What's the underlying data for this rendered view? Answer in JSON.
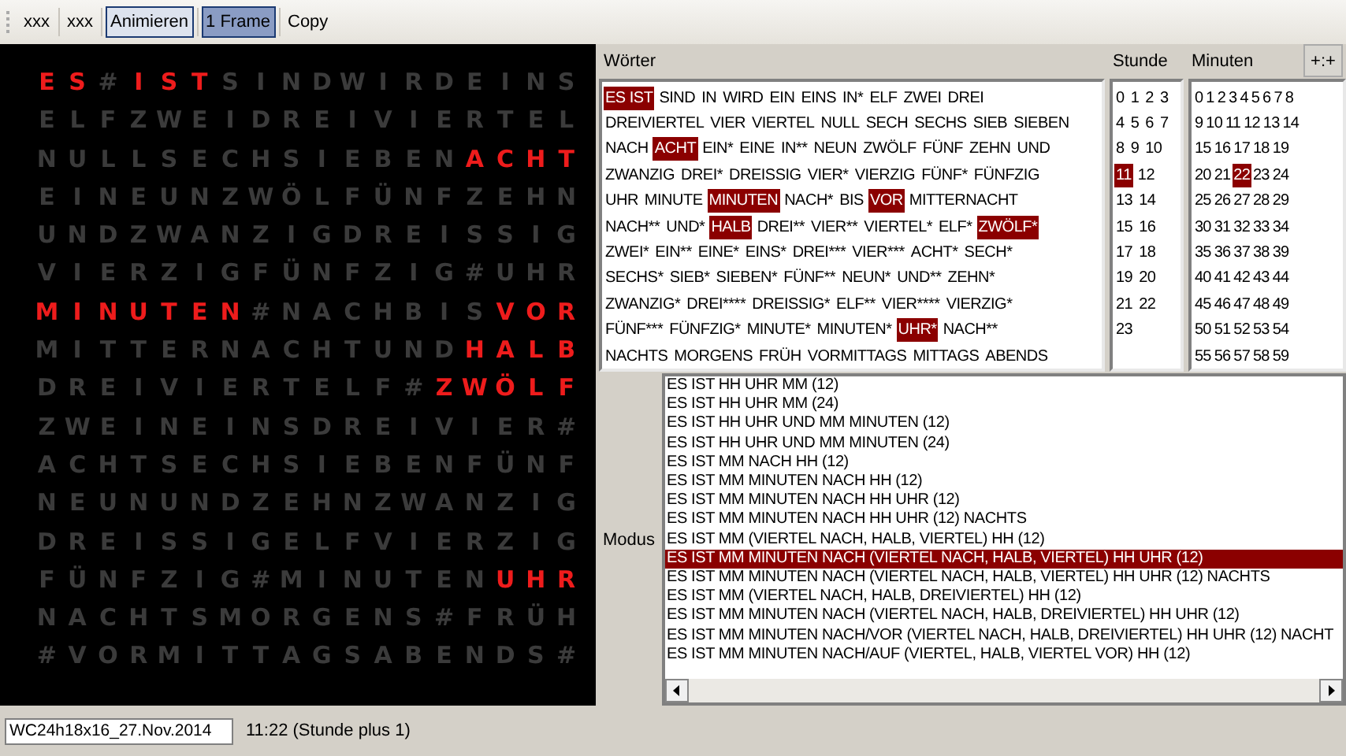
{
  "toolbar": {
    "buttons": [
      {
        "label": "xxx",
        "highlighted": false,
        "pressed": false
      },
      {
        "label": "xxx",
        "highlighted": false,
        "pressed": false
      },
      {
        "label": "Animieren",
        "highlighted": true,
        "pressed": false
      },
      {
        "label": "1 Frame",
        "highlighted": false,
        "pressed": true
      },
      {
        "label": "Copy",
        "highlighted": false,
        "pressed": false
      }
    ]
  },
  "clock_face": {
    "rows": [
      [
        {
          "c": "E",
          "lit": true
        },
        {
          "c": "S",
          "lit": true
        },
        {
          "c": "#",
          "lit": false
        },
        {
          "c": "I",
          "lit": true
        },
        {
          "c": "S",
          "lit": true
        },
        {
          "c": "T",
          "lit": true
        },
        {
          "c": "S",
          "lit": false
        },
        {
          "c": "I",
          "lit": false
        },
        {
          "c": "N",
          "lit": false
        },
        {
          "c": "D",
          "lit": false
        },
        {
          "c": "W",
          "lit": false
        },
        {
          "c": "I",
          "lit": false
        },
        {
          "c": "R",
          "lit": false
        },
        {
          "c": "D",
          "lit": false
        },
        {
          "c": "E",
          "lit": false
        },
        {
          "c": "I",
          "lit": false
        },
        {
          "c": "N",
          "lit": false
        },
        {
          "c": "S",
          "lit": false
        }
      ],
      [
        {
          "c": "E",
          "lit": false
        },
        {
          "c": "L",
          "lit": false
        },
        {
          "c": "F",
          "lit": false
        },
        {
          "c": "Z",
          "lit": false
        },
        {
          "c": "W",
          "lit": false
        },
        {
          "c": "E",
          "lit": false
        },
        {
          "c": "I",
          "lit": false
        },
        {
          "c": "D",
          "lit": false
        },
        {
          "c": "R",
          "lit": false
        },
        {
          "c": "E",
          "lit": false
        },
        {
          "c": "I",
          "lit": false
        },
        {
          "c": "V",
          "lit": false
        },
        {
          "c": "I",
          "lit": false
        },
        {
          "c": "E",
          "lit": false
        },
        {
          "c": "R",
          "lit": false
        },
        {
          "c": "T",
          "lit": false
        },
        {
          "c": "E",
          "lit": false
        },
        {
          "c": "L",
          "lit": false
        }
      ],
      [
        {
          "c": "N",
          "lit": false
        },
        {
          "c": "U",
          "lit": false
        },
        {
          "c": "L",
          "lit": false
        },
        {
          "c": "L",
          "lit": false
        },
        {
          "c": "S",
          "lit": false
        },
        {
          "c": "E",
          "lit": false
        },
        {
          "c": "C",
          "lit": false
        },
        {
          "c": "H",
          "lit": false
        },
        {
          "c": "S",
          "lit": false
        },
        {
          "c": "I",
          "lit": false
        },
        {
          "c": "E",
          "lit": false
        },
        {
          "c": "B",
          "lit": false
        },
        {
          "c": "E",
          "lit": false
        },
        {
          "c": "N",
          "lit": false
        },
        {
          "c": "A",
          "lit": true
        },
        {
          "c": "C",
          "lit": true
        },
        {
          "c": "H",
          "lit": true
        },
        {
          "c": "T",
          "lit": true
        }
      ],
      [
        {
          "c": "E",
          "lit": false
        },
        {
          "c": "I",
          "lit": false
        },
        {
          "c": "N",
          "lit": false
        },
        {
          "c": "E",
          "lit": false
        },
        {
          "c": "U",
          "lit": false
        },
        {
          "c": "N",
          "lit": false
        },
        {
          "c": "Z",
          "lit": false
        },
        {
          "c": "W",
          "lit": false
        },
        {
          "c": "Ö",
          "lit": false
        },
        {
          "c": "L",
          "lit": false
        },
        {
          "c": "F",
          "lit": false
        },
        {
          "c": "Ü",
          "lit": false
        },
        {
          "c": "N",
          "lit": false
        },
        {
          "c": "F",
          "lit": false
        },
        {
          "c": "Z",
          "lit": false
        },
        {
          "c": "E",
          "lit": false
        },
        {
          "c": "H",
          "lit": false
        },
        {
          "c": "N",
          "lit": false
        }
      ],
      [
        {
          "c": "U",
          "lit": false
        },
        {
          "c": "N",
          "lit": false
        },
        {
          "c": "D",
          "lit": false
        },
        {
          "c": "Z",
          "lit": false
        },
        {
          "c": "W",
          "lit": false
        },
        {
          "c": "A",
          "lit": false
        },
        {
          "c": "N",
          "lit": false
        },
        {
          "c": "Z",
          "lit": false
        },
        {
          "c": "I",
          "lit": false
        },
        {
          "c": "G",
          "lit": false
        },
        {
          "c": "D",
          "lit": false
        },
        {
          "c": "R",
          "lit": false
        },
        {
          "c": "E",
          "lit": false
        },
        {
          "c": "I",
          "lit": false
        },
        {
          "c": "S",
          "lit": false
        },
        {
          "c": "S",
          "lit": false
        },
        {
          "c": "I",
          "lit": false
        },
        {
          "c": "G",
          "lit": false
        }
      ],
      [
        {
          "c": "V",
          "lit": false
        },
        {
          "c": "I",
          "lit": false
        },
        {
          "c": "E",
          "lit": false
        },
        {
          "c": "R",
          "lit": false
        },
        {
          "c": "Z",
          "lit": false
        },
        {
          "c": "I",
          "lit": false
        },
        {
          "c": "G",
          "lit": false
        },
        {
          "c": "F",
          "lit": false
        },
        {
          "c": "Ü",
          "lit": false
        },
        {
          "c": "N",
          "lit": false
        },
        {
          "c": "F",
          "lit": false
        },
        {
          "c": "Z",
          "lit": false
        },
        {
          "c": "I",
          "lit": false
        },
        {
          "c": "G",
          "lit": false
        },
        {
          "c": "#",
          "lit": false
        },
        {
          "c": "U",
          "lit": false
        },
        {
          "c": "H",
          "lit": false
        },
        {
          "c": "R",
          "lit": false
        }
      ],
      [
        {
          "c": "M",
          "lit": true
        },
        {
          "c": "I",
          "lit": true
        },
        {
          "c": "N",
          "lit": true
        },
        {
          "c": "U",
          "lit": true
        },
        {
          "c": "T",
          "lit": true
        },
        {
          "c": "E",
          "lit": true
        },
        {
          "c": "N",
          "lit": true
        },
        {
          "c": "#",
          "lit": false
        },
        {
          "c": "N",
          "lit": false
        },
        {
          "c": "A",
          "lit": false
        },
        {
          "c": "C",
          "lit": false
        },
        {
          "c": "H",
          "lit": false
        },
        {
          "c": "B",
          "lit": false
        },
        {
          "c": "I",
          "lit": false
        },
        {
          "c": "S",
          "lit": false
        },
        {
          "c": "V",
          "lit": true
        },
        {
          "c": "O",
          "lit": true
        },
        {
          "c": "R",
          "lit": true
        }
      ],
      [
        {
          "c": "M",
          "lit": false
        },
        {
          "c": "I",
          "lit": false
        },
        {
          "c": "T",
          "lit": false
        },
        {
          "c": "T",
          "lit": false
        },
        {
          "c": "E",
          "lit": false
        },
        {
          "c": "R",
          "lit": false
        },
        {
          "c": "N",
          "lit": false
        },
        {
          "c": "A",
          "lit": false
        },
        {
          "c": "C",
          "lit": false
        },
        {
          "c": "H",
          "lit": false
        },
        {
          "c": "T",
          "lit": false
        },
        {
          "c": "U",
          "lit": false
        },
        {
          "c": "N",
          "lit": false
        },
        {
          "c": "D",
          "lit": false
        },
        {
          "c": "H",
          "lit": true
        },
        {
          "c": "A",
          "lit": true
        },
        {
          "c": "L",
          "lit": true
        },
        {
          "c": "B",
          "lit": true
        }
      ],
      [
        {
          "c": "D",
          "lit": false
        },
        {
          "c": "R",
          "lit": false
        },
        {
          "c": "E",
          "lit": false
        },
        {
          "c": "I",
          "lit": false
        },
        {
          "c": "V",
          "lit": false
        },
        {
          "c": "I",
          "lit": false
        },
        {
          "c": "E",
          "lit": false
        },
        {
          "c": "R",
          "lit": false
        },
        {
          "c": "T",
          "lit": false
        },
        {
          "c": "E",
          "lit": false
        },
        {
          "c": "L",
          "lit": false
        },
        {
          "c": "F",
          "lit": false
        },
        {
          "c": "#",
          "lit": false
        },
        {
          "c": "Z",
          "lit": true
        },
        {
          "c": "W",
          "lit": true
        },
        {
          "c": "Ö",
          "lit": true
        },
        {
          "c": "L",
          "lit": true
        },
        {
          "c": "F",
          "lit": true
        }
      ],
      [
        {
          "c": "Z",
          "lit": false
        },
        {
          "c": "W",
          "lit": false
        },
        {
          "c": "E",
          "lit": false
        },
        {
          "c": "I",
          "lit": false
        },
        {
          "c": "N",
          "lit": false
        },
        {
          "c": "E",
          "lit": false
        },
        {
          "c": "I",
          "lit": false
        },
        {
          "c": "N",
          "lit": false
        },
        {
          "c": "S",
          "lit": false
        },
        {
          "c": "D",
          "lit": false
        },
        {
          "c": "R",
          "lit": false
        },
        {
          "c": "E",
          "lit": false
        },
        {
          "c": "I",
          "lit": false
        },
        {
          "c": "V",
          "lit": false
        },
        {
          "c": "I",
          "lit": false
        },
        {
          "c": "E",
          "lit": false
        },
        {
          "c": "R",
          "lit": false
        },
        {
          "c": "#",
          "lit": false
        }
      ],
      [
        {
          "c": "A",
          "lit": false
        },
        {
          "c": "C",
          "lit": false
        },
        {
          "c": "H",
          "lit": false
        },
        {
          "c": "T",
          "lit": false
        },
        {
          "c": "S",
          "lit": false
        },
        {
          "c": "E",
          "lit": false
        },
        {
          "c": "C",
          "lit": false
        },
        {
          "c": "H",
          "lit": false
        },
        {
          "c": "S",
          "lit": false
        },
        {
          "c": "I",
          "lit": false
        },
        {
          "c": "E",
          "lit": false
        },
        {
          "c": "B",
          "lit": false
        },
        {
          "c": "E",
          "lit": false
        },
        {
          "c": "N",
          "lit": false
        },
        {
          "c": "F",
          "lit": false
        },
        {
          "c": "Ü",
          "lit": false
        },
        {
          "c": "N",
          "lit": false
        },
        {
          "c": "F",
          "lit": false
        }
      ],
      [
        {
          "c": "N",
          "lit": false
        },
        {
          "c": "E",
          "lit": false
        },
        {
          "c": "U",
          "lit": false
        },
        {
          "c": "N",
          "lit": false
        },
        {
          "c": "U",
          "lit": false
        },
        {
          "c": "N",
          "lit": false
        },
        {
          "c": "D",
          "lit": false
        },
        {
          "c": "Z",
          "lit": false
        },
        {
          "c": "E",
          "lit": false
        },
        {
          "c": "H",
          "lit": false
        },
        {
          "c": "N",
          "lit": false
        },
        {
          "c": "Z",
          "lit": false
        },
        {
          "c": "W",
          "lit": false
        },
        {
          "c": "A",
          "lit": false
        },
        {
          "c": "N",
          "lit": false
        },
        {
          "c": "Z",
          "lit": false
        },
        {
          "c": "I",
          "lit": false
        },
        {
          "c": "G",
          "lit": false
        }
      ],
      [
        {
          "c": "D",
          "lit": false
        },
        {
          "c": "R",
          "lit": false
        },
        {
          "c": "E",
          "lit": false
        },
        {
          "c": "I",
          "lit": false
        },
        {
          "c": "S",
          "lit": false
        },
        {
          "c": "S",
          "lit": false
        },
        {
          "c": "I",
          "lit": false
        },
        {
          "c": "G",
          "lit": false
        },
        {
          "c": "E",
          "lit": false
        },
        {
          "c": "L",
          "lit": false
        },
        {
          "c": "F",
          "lit": false
        },
        {
          "c": "V",
          "lit": false
        },
        {
          "c": "I",
          "lit": false
        },
        {
          "c": "E",
          "lit": false
        },
        {
          "c": "R",
          "lit": false
        },
        {
          "c": "Z",
          "lit": false
        },
        {
          "c": "I",
          "lit": false
        },
        {
          "c": "G",
          "lit": false
        }
      ],
      [
        {
          "c": "F",
          "lit": false
        },
        {
          "c": "Ü",
          "lit": false
        },
        {
          "c": "N",
          "lit": false
        },
        {
          "c": "F",
          "lit": false
        },
        {
          "c": "Z",
          "lit": false
        },
        {
          "c": "I",
          "lit": false
        },
        {
          "c": "G",
          "lit": false
        },
        {
          "c": "#",
          "lit": false
        },
        {
          "c": "M",
          "lit": false
        },
        {
          "c": "I",
          "lit": false
        },
        {
          "c": "N",
          "lit": false
        },
        {
          "c": "U",
          "lit": false
        },
        {
          "c": "T",
          "lit": false
        },
        {
          "c": "E",
          "lit": false
        },
        {
          "c": "N",
          "lit": false
        },
        {
          "c": "U",
          "lit": true
        },
        {
          "c": "H",
          "lit": true
        },
        {
          "c": "R",
          "lit": true
        }
      ],
      [
        {
          "c": "N",
          "lit": false
        },
        {
          "c": "A",
          "lit": false
        },
        {
          "c": "C",
          "lit": false
        },
        {
          "c": "H",
          "lit": false
        },
        {
          "c": "T",
          "lit": false
        },
        {
          "c": "S",
          "lit": false
        },
        {
          "c": "M",
          "lit": false
        },
        {
          "c": "O",
          "lit": false
        },
        {
          "c": "R",
          "lit": false
        },
        {
          "c": "G",
          "lit": false
        },
        {
          "c": "E",
          "lit": false
        },
        {
          "c": "N",
          "lit": false
        },
        {
          "c": "S",
          "lit": false
        },
        {
          "c": "#",
          "lit": false
        },
        {
          "c": "F",
          "lit": false
        },
        {
          "c": "R",
          "lit": false
        },
        {
          "c": "Ü",
          "lit": false
        },
        {
          "c": "H",
          "lit": false
        }
      ],
      [
        {
          "c": "#",
          "lit": false
        },
        {
          "c": "V",
          "lit": false
        },
        {
          "c": "O",
          "lit": false
        },
        {
          "c": "R",
          "lit": false
        },
        {
          "c": "M",
          "lit": false
        },
        {
          "c": "I",
          "lit": false
        },
        {
          "c": "T",
          "lit": false
        },
        {
          "c": "T",
          "lit": false
        },
        {
          "c": "A",
          "lit": false
        },
        {
          "c": "G",
          "lit": false
        },
        {
          "c": "S",
          "lit": false
        },
        {
          "c": "A",
          "lit": false
        },
        {
          "c": "B",
          "lit": false
        },
        {
          "c": "E",
          "lit": false
        },
        {
          "c": "N",
          "lit": false
        },
        {
          "c": "D",
          "lit": false
        },
        {
          "c": "S",
          "lit": false
        },
        {
          "c": "#",
          "lit": false
        }
      ]
    ]
  },
  "words": {
    "label": "Wörter",
    "lines": [
      [
        {
          "text": "ES IST",
          "selected": true
        },
        {
          "text": "SIND",
          "selected": false
        },
        {
          "text": "IN",
          "selected": false
        },
        {
          "text": "WIRD",
          "selected": false
        },
        {
          "text": "EIN",
          "selected": false
        },
        {
          "text": "EINS",
          "selected": false
        },
        {
          "text": "IN*",
          "selected": false
        },
        {
          "text": "ELF",
          "selected": false
        },
        {
          "text": "ZWEI",
          "selected": false
        },
        {
          "text": "DREI",
          "selected": false
        }
      ],
      [
        {
          "text": "DREIVIERTEL",
          "selected": false
        },
        {
          "text": "VIER",
          "selected": false
        },
        {
          "text": "VIERTEL",
          "selected": false
        },
        {
          "text": "NULL",
          "selected": false
        },
        {
          "text": "SECH",
          "selected": false
        },
        {
          "text": "SECHS",
          "selected": false
        },
        {
          "text": "SIEB",
          "selected": false
        },
        {
          "text": "SIEBEN",
          "selected": false
        }
      ],
      [
        {
          "text": "NACH",
          "selected": false
        },
        {
          "text": "ACHT",
          "selected": true
        },
        {
          "text": "EIN*",
          "selected": false
        },
        {
          "text": "EINE",
          "selected": false
        },
        {
          "text": "IN**",
          "selected": false
        },
        {
          "text": "NEUN",
          "selected": false
        },
        {
          "text": "ZWÖLF",
          "selected": false
        },
        {
          "text": "FÜNF",
          "selected": false
        },
        {
          "text": "ZEHN",
          "selected": false
        },
        {
          "text": "UND",
          "selected": false
        }
      ],
      [
        {
          "text": "ZWANZIG",
          "selected": false
        },
        {
          "text": "DREI*",
          "selected": false
        },
        {
          "text": "DREISSIG",
          "selected": false
        },
        {
          "text": "VIER*",
          "selected": false
        },
        {
          "text": "VIERZIG",
          "selected": false
        },
        {
          "text": "FÜNF*",
          "selected": false
        },
        {
          "text": "FÜNFZIG",
          "selected": false
        }
      ],
      [
        {
          "text": "UHR",
          "selected": false
        },
        {
          "text": "MINUTE",
          "selected": false
        },
        {
          "text": "MINUTEN",
          "selected": true
        },
        {
          "text": "NACH*",
          "selected": false
        },
        {
          "text": "BIS",
          "selected": false
        },
        {
          "text": "VOR",
          "selected": true
        },
        {
          "text": "MITTERNACHT",
          "selected": false
        }
      ],
      [
        {
          "text": "NACH**",
          "selected": false
        },
        {
          "text": "UND*",
          "selected": false
        },
        {
          "text": "HALB",
          "selected": true
        },
        {
          "text": "DREI**",
          "selected": false
        },
        {
          "text": "VIER**",
          "selected": false
        },
        {
          "text": "VIERTEL*",
          "selected": false
        },
        {
          "text": "ELF*",
          "selected": false
        },
        {
          "text": "ZWÖLF*",
          "selected": true
        }
      ],
      [
        {
          "text": "ZWEI*",
          "selected": false
        },
        {
          "text": "EIN**",
          "selected": false
        },
        {
          "text": "EINE*",
          "selected": false
        },
        {
          "text": "EINS*",
          "selected": false
        },
        {
          "text": "DREI***",
          "selected": false
        },
        {
          "text": "VIER***",
          "selected": false
        },
        {
          "text": "ACHT*",
          "selected": false
        },
        {
          "text": "SECH*",
          "selected": false
        }
      ],
      [
        {
          "text": "SECHS*",
          "selected": false
        },
        {
          "text": "SIEB*",
          "selected": false
        },
        {
          "text": "SIEBEN*",
          "selected": false
        },
        {
          "text": "FÜNF**",
          "selected": false
        },
        {
          "text": "NEUN*",
          "selected": false
        },
        {
          "text": "UND**",
          "selected": false
        },
        {
          "text": "ZEHN*",
          "selected": false
        }
      ],
      [
        {
          "text": "ZWANZIG*",
          "selected": false
        },
        {
          "text": "DREI****",
          "selected": false
        },
        {
          "text": "DREISSIG*",
          "selected": false
        },
        {
          "text": "ELF**",
          "selected": false
        },
        {
          "text": "VIER****",
          "selected": false
        },
        {
          "text": "VIERZIG*",
          "selected": false
        }
      ],
      [
        {
          "text": "FÜNF***",
          "selected": false
        },
        {
          "text": "FÜNFZIG*",
          "selected": false
        },
        {
          "text": "MINUTE*",
          "selected": false
        },
        {
          "text": "MINUTEN*",
          "selected": false
        },
        {
          "text": "UHR*",
          "selected": true
        },
        {
          "text": "NACH**",
          "selected": false
        }
      ],
      [
        {
          "text": "NACHTS",
          "selected": false
        },
        {
          "text": "MORGENS",
          "selected": false
        },
        {
          "text": "FRÜH",
          "selected": false
        },
        {
          "text": "VORMITTAGS",
          "selected": false
        },
        {
          "text": "MITTAGS",
          "selected": false
        },
        {
          "text": "ABENDS",
          "selected": false
        }
      ]
    ]
  },
  "hours": {
    "label": "Stunde",
    "lines": [
      [
        {
          "text": "0",
          "selected": false
        },
        {
          "text": "1",
          "selected": false
        },
        {
          "text": "2",
          "selected": false
        },
        {
          "text": "3",
          "selected": false
        }
      ],
      [
        {
          "text": "4",
          "selected": false
        },
        {
          "text": "5",
          "selected": false
        },
        {
          "text": "6",
          "selected": false
        },
        {
          "text": "7",
          "selected": false
        }
      ],
      [
        {
          "text": "8",
          "selected": false
        },
        {
          "text": "9",
          "selected": false
        },
        {
          "text": "10",
          "selected": false
        }
      ],
      [
        {
          "text": "11",
          "selected": true
        },
        {
          "text": "12",
          "selected": false
        }
      ],
      [
        {
          "text": "13",
          "selected": false
        },
        {
          "text": "14",
          "selected": false
        }
      ],
      [
        {
          "text": "15",
          "selected": false
        },
        {
          "text": "16",
          "selected": false
        }
      ],
      [
        {
          "text": "17",
          "selected": false
        },
        {
          "text": "18",
          "selected": false
        }
      ],
      [
        {
          "text": "19",
          "selected": false
        },
        {
          "text": "20",
          "selected": false
        }
      ],
      [
        {
          "text": "21",
          "selected": false
        },
        {
          "text": "22",
          "selected": false
        }
      ],
      [
        {
          "text": "23",
          "selected": false
        }
      ]
    ]
  },
  "minutes": {
    "label": "Minuten",
    "button": "+:+",
    "lines": [
      [
        {
          "text": "0",
          "selected": false
        },
        {
          "text": "1",
          "selected": false
        },
        {
          "text": "2",
          "selected": false
        },
        {
          "text": "3",
          "selected": false
        },
        {
          "text": "4",
          "selected": false
        },
        {
          "text": "5",
          "selected": false
        },
        {
          "text": "6",
          "selected": false
        },
        {
          "text": "7",
          "selected": false
        },
        {
          "text": "8",
          "selected": false
        }
      ],
      [
        {
          "text": "9",
          "selected": false
        },
        {
          "text": "10",
          "selected": false
        },
        {
          "text": "11",
          "selected": false
        },
        {
          "text": "12",
          "selected": false
        },
        {
          "text": "13",
          "selected": false
        },
        {
          "text": "14",
          "selected": false
        }
      ],
      [
        {
          "text": "15",
          "selected": false
        },
        {
          "text": "16",
          "selected": false
        },
        {
          "text": "17",
          "selected": false
        },
        {
          "text": "18",
          "selected": false
        },
        {
          "text": "19",
          "selected": false
        }
      ],
      [
        {
          "text": "20",
          "selected": false
        },
        {
          "text": "21",
          "selected": false
        },
        {
          "text": "22",
          "selected": true
        },
        {
          "text": "23",
          "selected": false
        },
        {
          "text": "24",
          "selected": false
        }
      ],
      [
        {
          "text": "25",
          "selected": false
        },
        {
          "text": "26",
          "selected": false
        },
        {
          "text": "27",
          "selected": false
        },
        {
          "text": "28",
          "selected": false
        },
        {
          "text": "29",
          "selected": false
        }
      ],
      [
        {
          "text": "30",
          "selected": false
        },
        {
          "text": "31",
          "selected": false
        },
        {
          "text": "32",
          "selected": false
        },
        {
          "text": "33",
          "selected": false
        },
        {
          "text": "34",
          "selected": false
        }
      ],
      [
        {
          "text": "35",
          "selected": false
        },
        {
          "text": "36",
          "selected": false
        },
        {
          "text": "37",
          "selected": false
        },
        {
          "text": "38",
          "selected": false
        },
        {
          "text": "39",
          "selected": false
        }
      ],
      [
        {
          "text": "40",
          "selected": false
        },
        {
          "text": "41",
          "selected": false
        },
        {
          "text": "42",
          "selected": false
        },
        {
          "text": "43",
          "selected": false
        },
        {
          "text": "44",
          "selected": false
        }
      ],
      [
        {
          "text": "45",
          "selected": false
        },
        {
          "text": "46",
          "selected": false
        },
        {
          "text": "47",
          "selected": false
        },
        {
          "text": "48",
          "selected": false
        },
        {
          "text": "49",
          "selected": false
        }
      ],
      [
        {
          "text": "50",
          "selected": false
        },
        {
          "text": "51",
          "selected": false
        },
        {
          "text": "52",
          "selected": false
        },
        {
          "text": "53",
          "selected": false
        },
        {
          "text": "54",
          "selected": false
        }
      ],
      [
        {
          "text": "55",
          "selected": false
        },
        {
          "text": "56",
          "selected": false
        },
        {
          "text": "57",
          "selected": false
        },
        {
          "text": "58",
          "selected": false
        },
        {
          "text": "59",
          "selected": false
        }
      ]
    ]
  },
  "mode": {
    "label": "Modus",
    "items": [
      {
        "text": "ES IST HH UHR MM (12)",
        "selected": false
      },
      {
        "text": "ES IST HH UHR MM (24)",
        "selected": false
      },
      {
        "text": "ES IST HH UHR UND MM MINUTEN (12)",
        "selected": false
      },
      {
        "text": "ES IST HH UHR UND MM MINUTEN (24)",
        "selected": false
      },
      {
        "text": "ES IST MM NACH HH (12)",
        "selected": false
      },
      {
        "text": "ES IST MM MINUTEN NACH HH (12)",
        "selected": false
      },
      {
        "text": "ES IST MM MINUTEN NACH HH UHR (12)",
        "selected": false
      },
      {
        "text": "ES IST MM MINUTEN NACH HH UHR (12) NACHTS",
        "selected": false
      },
      {
        "text": "ES IST MM (VIERTEL NACH, HALB, VIERTEL) HH (12)",
        "selected": false
      },
      {
        "text": "ES IST MM MINUTEN NACH (VIERTEL NACH, HALB, VIERTEL) HH UHR (12)",
        "selected": true
      },
      {
        "text": "ES IST MM MINUTEN NACH (VIERTEL NACH, HALB, VIERTEL) HH UHR (12) NACHTS",
        "selected": false
      },
      {
        "text": "ES IST MM (VIERTEL NACH, HALB, DREIVIERTEL) HH (12)",
        "selected": false
      },
      {
        "text": "ES IST MM MINUTEN NACH (VIERTEL NACH, HALB, DREIVIERTEL) HH UHR (12)",
        "selected": false
      },
      {
        "text": "ES IST MM MINUTEN NACH/VOR (VIERTEL NACH, HALB, DREIVIERTEL) HH UHR (12) NACHT",
        "selected": false
      },
      {
        "text": "ES IST MM MINUTEN NACH/AUF (VIERTEL, HALB, VIERTEL VOR) HH (12)",
        "selected": false
      }
    ]
  },
  "status_bar": {
    "file_name": "WC24h18x16_27.Nov.2014",
    "time_text": "11:22 (Stunde plus 1)"
  }
}
